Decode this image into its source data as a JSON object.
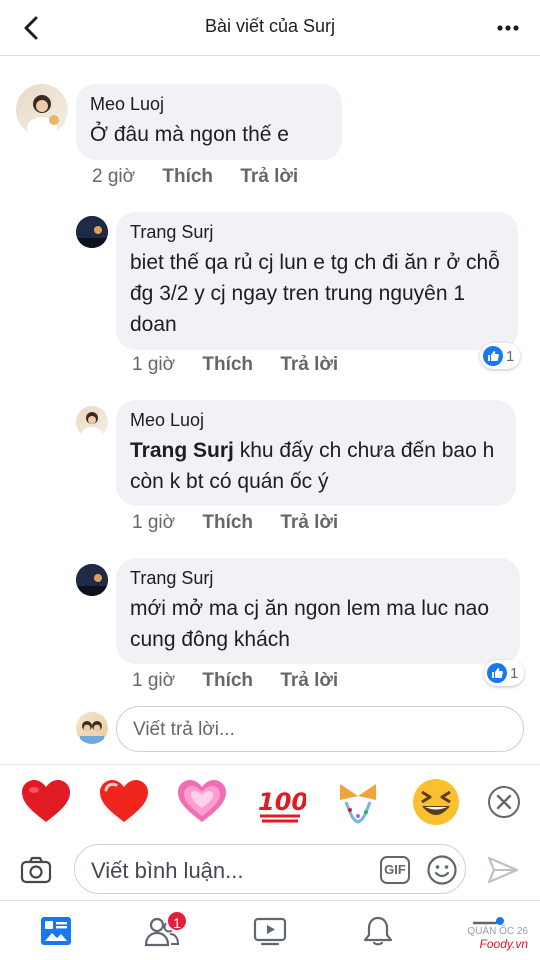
{
  "header": {
    "title": "Bài viết của Surj"
  },
  "comments": [
    {
      "name": "Meo Luoj",
      "text": "Ở đâu mà ngon thế e",
      "time": "2 giờ",
      "like": "Thích",
      "reply": "Trả lời"
    },
    {
      "name": "Trang Surj",
      "text": "biet thế qa rủ cj lun e tg ch đi ăn r ở chỗ đg 3/2 y cj ngay tren trung nguyên 1 doan",
      "time": "1 giờ",
      "like": "Thích",
      "reply": "Trả lời",
      "reactions": "1"
    },
    {
      "name": "Meo Luoj",
      "tag": "Trang Surj",
      "text": " khu đấy ch chưa đến bao h còn k bt có quán ốc ý",
      "time": "1 giờ",
      "like": "Thích",
      "reply": "Trả lời"
    },
    {
      "name": "Trang Surj",
      "text": "mới mở ma cj ăn ngon lem ma luc nao cung đông khách",
      "time": "1 giờ",
      "like": "Thích",
      "reply": "Trả lời",
      "reactions": "1"
    }
  ],
  "reply_box": {
    "placeholder": "Viết trả lời..."
  },
  "emoji_bar": {
    "items": [
      "red-heart",
      "heavy-heart",
      "sparkling-heart",
      "hundred-points",
      "party-popper",
      "grinning-squinting-face"
    ]
  },
  "composer": {
    "placeholder": "Viết bình luận...",
    "gif_label": "GIF"
  },
  "nav": {
    "friends_badge": "1"
  },
  "watermark": {
    "line1": "QUÁN ỐC 26",
    "line2": "Foody.vn"
  },
  "colors": {
    "accent": "#1877f2",
    "badge": "#e41e3f",
    "bubble": "#f0f2f5"
  }
}
